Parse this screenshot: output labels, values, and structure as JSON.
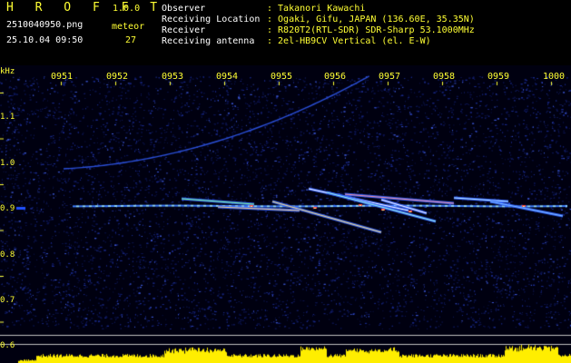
{
  "header": {
    "app_name": "H R O F F T",
    "version": "1.0.0",
    "filename": "2510040950.png",
    "datetime": "25.10.04 09:50",
    "meteor_label": "meteor",
    "meteor_count": "27",
    "info": [
      {
        "label": "Observer",
        "value": ": Takanori Kawachi"
      },
      {
        "label": "Receiving Location",
        "value": ": Ogaki, Gifu, JAPAN (136.60E, 35.35N)"
      },
      {
        "label": "Receiver",
        "value": ": R820T2(RTL-SDR) SDR-Sharp 53.1000MHz"
      },
      {
        "label": "Receiving antenna",
        "value": ": 2el-HB9CV Vertical (el. E-W)"
      }
    ]
  },
  "axis": {
    "unit": "kHz",
    "y_ticks": [
      "1.1",
      "1.0",
      "0.9",
      "0.8",
      "0.7",
      "0.6"
    ],
    "x_ticks": [
      "0951",
      "0952",
      "0953",
      "0954",
      "0955",
      "0956",
      "0957",
      "0958",
      "0959",
      "1000"
    ]
  },
  "colors": {
    "background": "#000010",
    "text_yellow": "#ffff33",
    "text_white": "#ffffff",
    "noise": "#1a2a8a",
    "signal": "#ffffff",
    "bars": "#ffee00"
  }
}
